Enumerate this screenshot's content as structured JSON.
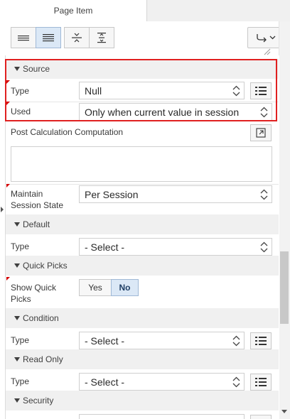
{
  "tabs": [
    {
      "label": "Page Item"
    }
  ],
  "toolbar": {
    "buttons": [
      {
        "name": "compact-layout",
        "icon": "compact-lines-icon"
      },
      {
        "name": "expanded-layout",
        "icon": "expanded-lines-icon",
        "active": true
      },
      {
        "name": "collapse-all",
        "icon": "collapse-all-icon"
      },
      {
        "name": "expand-all",
        "icon": "expand-all-icon"
      },
      {
        "name": "go-to-group",
        "icon": "go-to-icon"
      }
    ]
  },
  "sections": {
    "source": {
      "title": "Source",
      "type_label": "Type",
      "type_value": "Null",
      "used_label": "Used",
      "used_value": "Only when current value in session"
    },
    "post_calc": {
      "label": "Post Calculation Computation",
      "value": ""
    },
    "maintain": {
      "label": "Maintain Session State",
      "value": "Per Session"
    },
    "default": {
      "title": "Default",
      "type_label": "Type",
      "type_value": "- Select -"
    },
    "quick_picks": {
      "title": "Quick Picks",
      "label": "Show Quick Picks",
      "options": [
        "Yes",
        "No"
      ],
      "selected": "No"
    },
    "condition": {
      "title": "Condition",
      "type_label": "Type",
      "type_value": "- Select -"
    },
    "read_only": {
      "title": "Read Only",
      "type_label": "Type",
      "type_value": "- Select -"
    },
    "security": {
      "title": "Security"
    }
  },
  "colors": {
    "highlight": "#e02020",
    "required_marker": "#d40000",
    "active_toggle": "#dbe8f6"
  }
}
